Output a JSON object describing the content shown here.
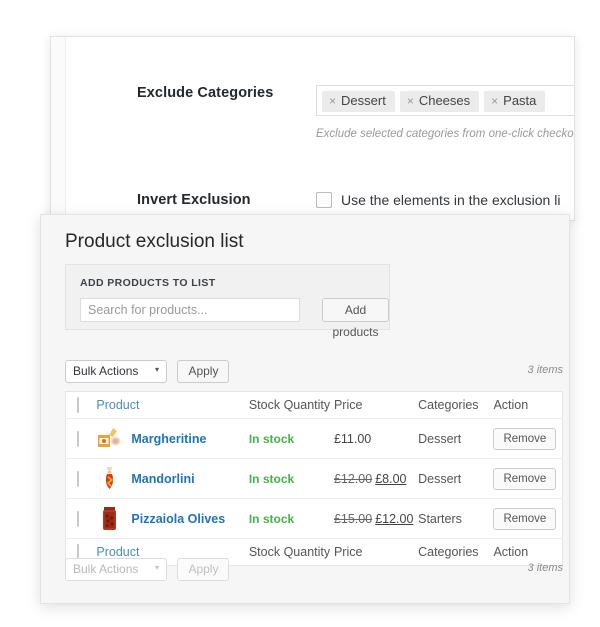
{
  "settings": {
    "exclude_categories": {
      "label": "Exclude Categories",
      "tags": [
        {
          "remove_icon": "×",
          "label": "Dessert"
        },
        {
          "remove_icon": "×",
          "label": "Cheeses"
        },
        {
          "remove_icon": "×",
          "label": "Pasta"
        }
      ],
      "help_text": "Exclude selected categories from one-click checkout fea"
    },
    "invert_exclusion": {
      "label": "Invert Exclusion",
      "checkbox_label": "Use the elements in the exclusion li",
      "checked": false
    }
  },
  "list_panel": {
    "title": "Product exclusion list",
    "add_box": {
      "title": "ADD PRODUCTS TO LIST",
      "search_placeholder": "Search for products...",
      "search_value": "",
      "add_button": "Add products"
    },
    "bulk_top": {
      "select_label": "Bulk Actions",
      "caret_icon": "▾",
      "apply_label": "Apply",
      "items_count": "3 items"
    },
    "bulk_bottom": {
      "select_label": "Bulk Actions",
      "caret_icon": "▾",
      "apply_label": "Apply",
      "items_count": "3 items"
    },
    "table": {
      "columns": [
        "Product",
        "Stock Quantity",
        "Price",
        "Categories",
        "Action"
      ],
      "rows": [
        {
          "name": "Margheritine",
          "thumb_icon": "biscuit-box-thumbnail",
          "stock": "In stock",
          "price_old": "",
          "price_new": "£11.00",
          "category": "Dessert",
          "action": "Remove"
        },
        {
          "name": "Mandorlini",
          "thumb_icon": "almond-jar-thumbnail",
          "stock": "In stock",
          "price_old": "£12.00",
          "price_new": "£8.00",
          "category": "Dessert",
          "action": "Remove"
        },
        {
          "name": "Pizzaiola Olives",
          "thumb_icon": "olive-jar-thumbnail",
          "stock": "In stock",
          "price_old": "£15.00",
          "price_new": "£12.00",
          "category": "Starters",
          "action": "Remove"
        }
      ]
    },
    "colors": {
      "link": "#1e73be",
      "in_stock": "#45b449",
      "panel_bg": "#f6f6f6"
    }
  }
}
